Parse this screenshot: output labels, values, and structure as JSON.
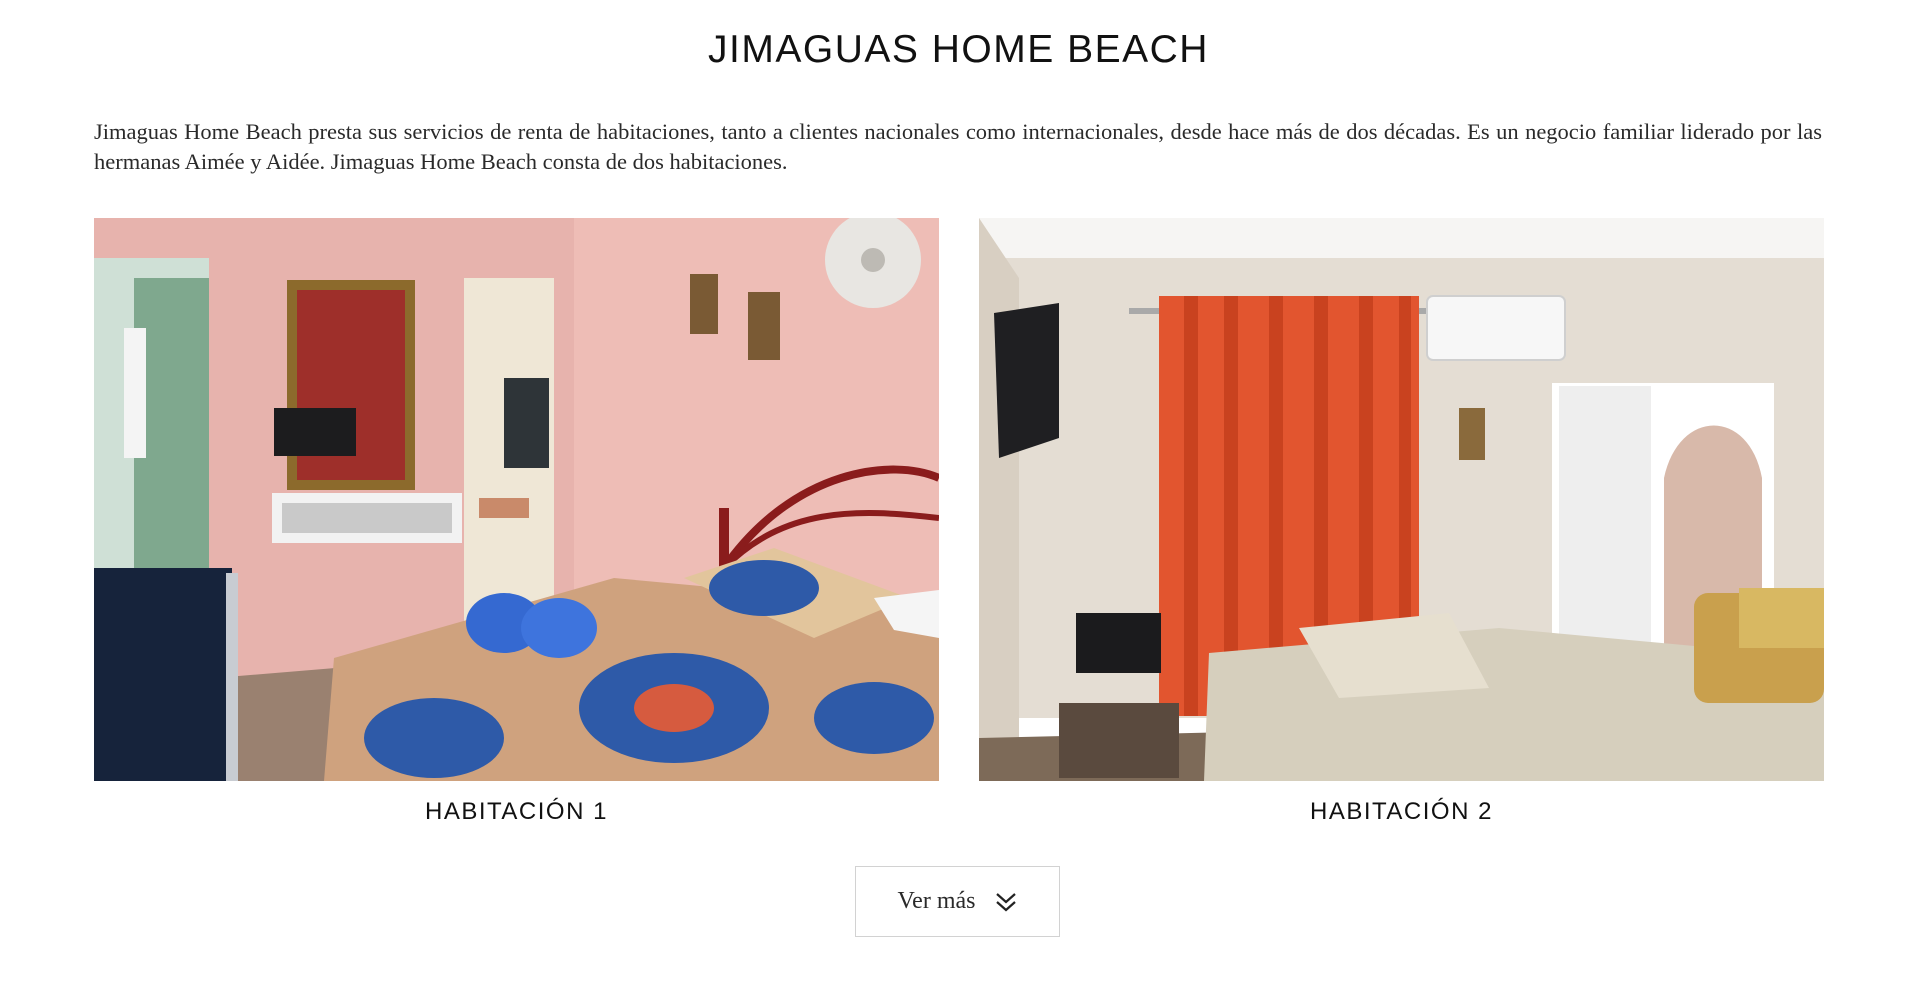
{
  "header": {
    "title": "JIMAGUAS HOME BEACH"
  },
  "intro": {
    "text": "Jimaguas Home Beach presta sus servicios de renta de habitaciones, tanto a clientes nacionales como internacionales, desde hace más de dos décadas. Es un negocio familiar liderado por las hermanas Aimée y Aidée. Jimaguas Home Beach consta de dos habitaciones."
  },
  "rooms": [
    {
      "label": "HABITACIÓN 1",
      "photo_alt": "Room 1 photo"
    },
    {
      "label": "HABITACIÓN 2",
      "photo_alt": "Room 2 photo"
    }
  ],
  "more_button": {
    "label": "Ver más",
    "icon": "double-chevron-down-icon"
  },
  "colors": {
    "text": "#111111",
    "button_border": "#d2d2d2",
    "room1_wall": "#e8b5b0",
    "room2_wall": "#e6e0d8",
    "curtain": "#e2552f"
  }
}
